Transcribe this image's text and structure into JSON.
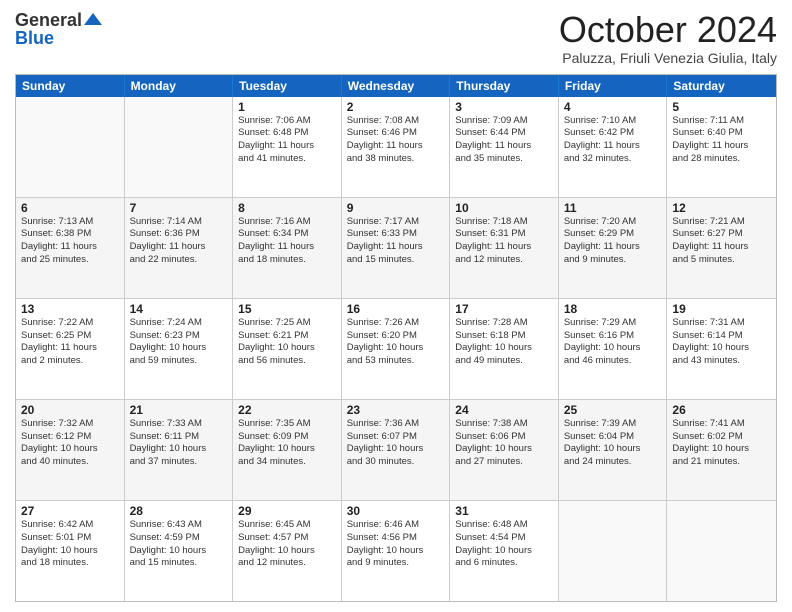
{
  "header": {
    "logo": {
      "line1": "General",
      "line2": "Blue"
    },
    "title": "October 2024",
    "subtitle": "Paluzza, Friuli Venezia Giulia, Italy"
  },
  "days": [
    "Sunday",
    "Monday",
    "Tuesday",
    "Wednesday",
    "Thursday",
    "Friday",
    "Saturday"
  ],
  "rows": [
    [
      {
        "day": "",
        "lines": []
      },
      {
        "day": "",
        "lines": []
      },
      {
        "day": "1",
        "lines": [
          "Sunrise: 7:06 AM",
          "Sunset: 6:48 PM",
          "Daylight: 11 hours",
          "and 41 minutes."
        ]
      },
      {
        "day": "2",
        "lines": [
          "Sunrise: 7:08 AM",
          "Sunset: 6:46 PM",
          "Daylight: 11 hours",
          "and 38 minutes."
        ]
      },
      {
        "day": "3",
        "lines": [
          "Sunrise: 7:09 AM",
          "Sunset: 6:44 PM",
          "Daylight: 11 hours",
          "and 35 minutes."
        ]
      },
      {
        "day": "4",
        "lines": [
          "Sunrise: 7:10 AM",
          "Sunset: 6:42 PM",
          "Daylight: 11 hours",
          "and 32 minutes."
        ]
      },
      {
        "day": "5",
        "lines": [
          "Sunrise: 7:11 AM",
          "Sunset: 6:40 PM",
          "Daylight: 11 hours",
          "and 28 minutes."
        ]
      }
    ],
    [
      {
        "day": "6",
        "lines": [
          "Sunrise: 7:13 AM",
          "Sunset: 6:38 PM",
          "Daylight: 11 hours",
          "and 25 minutes."
        ]
      },
      {
        "day": "7",
        "lines": [
          "Sunrise: 7:14 AM",
          "Sunset: 6:36 PM",
          "Daylight: 11 hours",
          "and 22 minutes."
        ]
      },
      {
        "day": "8",
        "lines": [
          "Sunrise: 7:16 AM",
          "Sunset: 6:34 PM",
          "Daylight: 11 hours",
          "and 18 minutes."
        ]
      },
      {
        "day": "9",
        "lines": [
          "Sunrise: 7:17 AM",
          "Sunset: 6:33 PM",
          "Daylight: 11 hours",
          "and 15 minutes."
        ]
      },
      {
        "day": "10",
        "lines": [
          "Sunrise: 7:18 AM",
          "Sunset: 6:31 PM",
          "Daylight: 11 hours",
          "and 12 minutes."
        ]
      },
      {
        "day": "11",
        "lines": [
          "Sunrise: 7:20 AM",
          "Sunset: 6:29 PM",
          "Daylight: 11 hours",
          "and 9 minutes."
        ]
      },
      {
        "day": "12",
        "lines": [
          "Sunrise: 7:21 AM",
          "Sunset: 6:27 PM",
          "Daylight: 11 hours",
          "and 5 minutes."
        ]
      }
    ],
    [
      {
        "day": "13",
        "lines": [
          "Sunrise: 7:22 AM",
          "Sunset: 6:25 PM",
          "Daylight: 11 hours",
          "and 2 minutes."
        ]
      },
      {
        "day": "14",
        "lines": [
          "Sunrise: 7:24 AM",
          "Sunset: 6:23 PM",
          "Daylight: 10 hours",
          "and 59 minutes."
        ]
      },
      {
        "day": "15",
        "lines": [
          "Sunrise: 7:25 AM",
          "Sunset: 6:21 PM",
          "Daylight: 10 hours",
          "and 56 minutes."
        ]
      },
      {
        "day": "16",
        "lines": [
          "Sunrise: 7:26 AM",
          "Sunset: 6:20 PM",
          "Daylight: 10 hours",
          "and 53 minutes."
        ]
      },
      {
        "day": "17",
        "lines": [
          "Sunrise: 7:28 AM",
          "Sunset: 6:18 PM",
          "Daylight: 10 hours",
          "and 49 minutes."
        ]
      },
      {
        "day": "18",
        "lines": [
          "Sunrise: 7:29 AM",
          "Sunset: 6:16 PM",
          "Daylight: 10 hours",
          "and 46 minutes."
        ]
      },
      {
        "day": "19",
        "lines": [
          "Sunrise: 7:31 AM",
          "Sunset: 6:14 PM",
          "Daylight: 10 hours",
          "and 43 minutes."
        ]
      }
    ],
    [
      {
        "day": "20",
        "lines": [
          "Sunrise: 7:32 AM",
          "Sunset: 6:12 PM",
          "Daylight: 10 hours",
          "and 40 minutes."
        ]
      },
      {
        "day": "21",
        "lines": [
          "Sunrise: 7:33 AM",
          "Sunset: 6:11 PM",
          "Daylight: 10 hours",
          "and 37 minutes."
        ]
      },
      {
        "day": "22",
        "lines": [
          "Sunrise: 7:35 AM",
          "Sunset: 6:09 PM",
          "Daylight: 10 hours",
          "and 34 minutes."
        ]
      },
      {
        "day": "23",
        "lines": [
          "Sunrise: 7:36 AM",
          "Sunset: 6:07 PM",
          "Daylight: 10 hours",
          "and 30 minutes."
        ]
      },
      {
        "day": "24",
        "lines": [
          "Sunrise: 7:38 AM",
          "Sunset: 6:06 PM",
          "Daylight: 10 hours",
          "and 27 minutes."
        ]
      },
      {
        "day": "25",
        "lines": [
          "Sunrise: 7:39 AM",
          "Sunset: 6:04 PM",
          "Daylight: 10 hours",
          "and 24 minutes."
        ]
      },
      {
        "day": "26",
        "lines": [
          "Sunrise: 7:41 AM",
          "Sunset: 6:02 PM",
          "Daylight: 10 hours",
          "and 21 minutes."
        ]
      }
    ],
    [
      {
        "day": "27",
        "lines": [
          "Sunrise: 6:42 AM",
          "Sunset: 5:01 PM",
          "Daylight: 10 hours",
          "and 18 minutes."
        ]
      },
      {
        "day": "28",
        "lines": [
          "Sunrise: 6:43 AM",
          "Sunset: 4:59 PM",
          "Daylight: 10 hours",
          "and 15 minutes."
        ]
      },
      {
        "day": "29",
        "lines": [
          "Sunrise: 6:45 AM",
          "Sunset: 4:57 PM",
          "Daylight: 10 hours",
          "and 12 minutes."
        ]
      },
      {
        "day": "30",
        "lines": [
          "Sunrise: 6:46 AM",
          "Sunset: 4:56 PM",
          "Daylight: 10 hours",
          "and 9 minutes."
        ]
      },
      {
        "day": "31",
        "lines": [
          "Sunrise: 6:48 AM",
          "Sunset: 4:54 PM",
          "Daylight: 10 hours",
          "and 6 minutes."
        ]
      },
      {
        "day": "",
        "lines": []
      },
      {
        "day": "",
        "lines": []
      }
    ]
  ]
}
